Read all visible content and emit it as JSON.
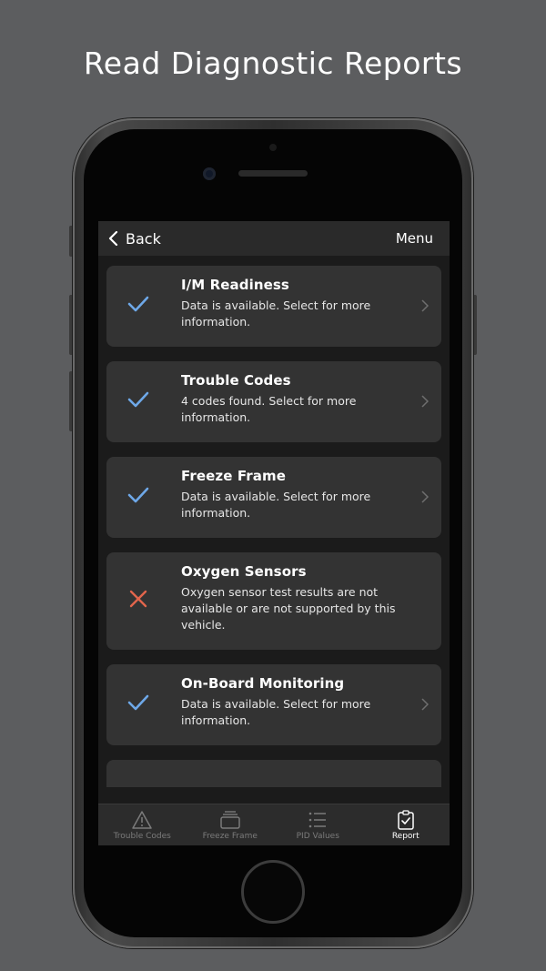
{
  "headline": "Read Diagnostic Reports",
  "nav": {
    "back_label": "Back",
    "menu_label": "Menu"
  },
  "reports": [
    {
      "title": "I/M Readiness",
      "description": "Data is available. Select for more information.",
      "status": "available"
    },
    {
      "title": "Trouble Codes",
      "description": "4 codes found. Select for more information.",
      "status": "available"
    },
    {
      "title": "Freeze Frame",
      "description": "Data is available. Select for more information.",
      "status": "available"
    },
    {
      "title": "Oxygen Sensors",
      "description": "Oxygen sensor test results are not available or are not supported by this vehicle.",
      "status": "unavailable"
    },
    {
      "title": "On-Board Monitoring",
      "description": "Data is available. Select for more information.",
      "status": "available"
    }
  ],
  "tabs": [
    {
      "label": "Trouble Codes",
      "icon": "warning-triangle-icon",
      "active": false
    },
    {
      "label": "Freeze Frame",
      "icon": "layers-icon",
      "active": false
    },
    {
      "label": "PID Values",
      "icon": "list-icon",
      "active": false
    },
    {
      "label": "Report",
      "icon": "clipboard-check-icon",
      "active": true
    }
  ],
  "colors": {
    "check": "#6ea8e8",
    "cross": "#e2654c",
    "card": "#333333",
    "background": "#5c5d5f"
  }
}
